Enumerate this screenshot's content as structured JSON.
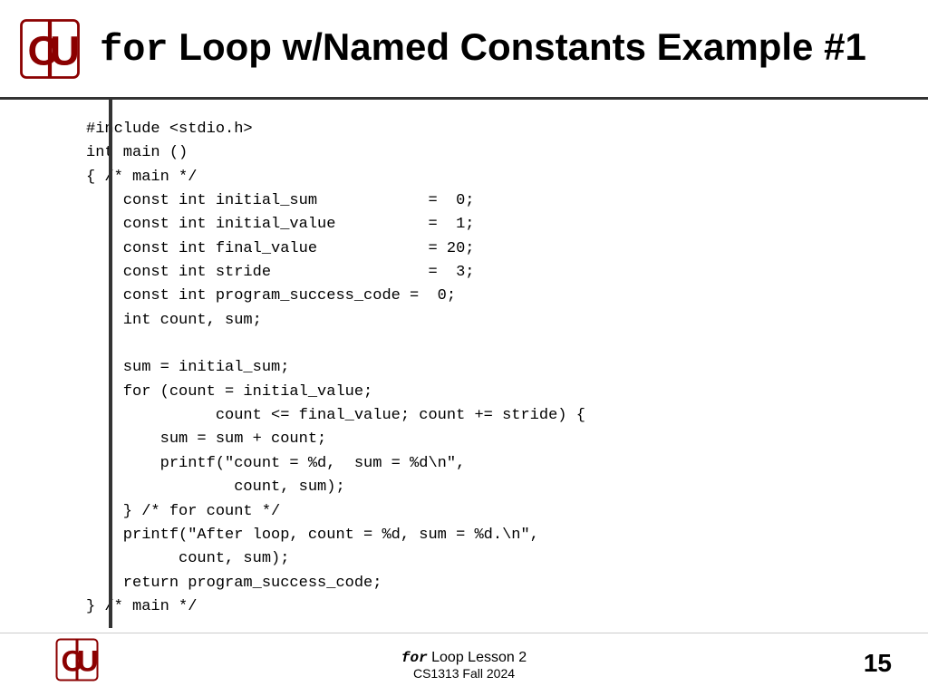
{
  "header": {
    "title_keyword": "for",
    "title_rest": "  Loop w/Named Constants Example #1"
  },
  "code": {
    "lines": [
      "#include <stdio.h>",
      "int main ()",
      "{ /* main */",
      "    const int initial_sum            =  0;",
      "    const int initial_value          =  1;",
      "    const int final_value            = 20;",
      "    const int stride                 =  3;",
      "    const int program_success_code =  0;",
      "    int count, sum;",
      "",
      "    sum = initial_sum;",
      "    for (count = initial_value;",
      "              count <= final_value; count += stride) {",
      "        sum = sum + count;",
      "        printf(\"count = %d,  sum = %d\\n\",",
      "                count, sum);",
      "    } /* for count */",
      "    printf(\"After loop, count = %d, sum = %d.\\n\",",
      "          count, sum);",
      "    return program_success_code;",
      "} /* main */"
    ]
  },
  "footer": {
    "keyword": "for",
    "lesson_text": " Loop Lesson 2",
    "subtitle": "CS1313 Fall 2024",
    "page_number": "15"
  }
}
